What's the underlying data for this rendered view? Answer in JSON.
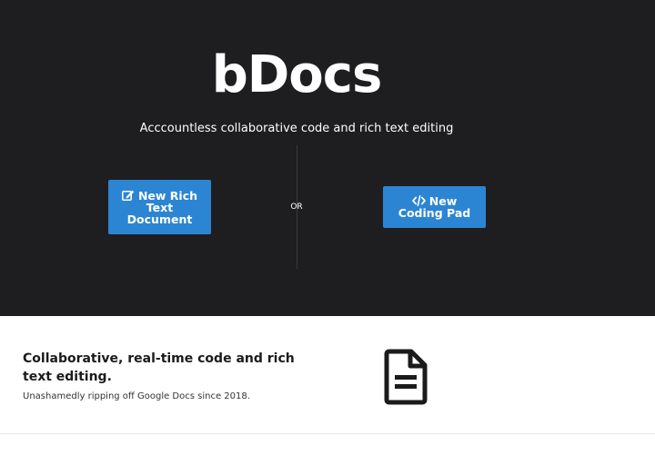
{
  "hero": {
    "title": "bDocs",
    "tagline": "Acccountless collaborative code and rich text editing",
    "or_label": "OR",
    "rich_button": {
      "line1": "New Rich",
      "line2": "Text",
      "line3": "Document",
      "icon": "edit-icon"
    },
    "code_button": {
      "line1": "New",
      "line2": "Coding Pad",
      "icon": "code-icon"
    }
  },
  "features": {
    "heading": "Collaborative, real-time code and rich text editing.",
    "subtext": "Unashamedly ripping off Google Docs since 2018.",
    "icon": "document-icon"
  },
  "colors": {
    "hero_bg": "#1e1e20",
    "button_bg": "#2c85d3",
    "text_dark": "#1b1b1b"
  }
}
